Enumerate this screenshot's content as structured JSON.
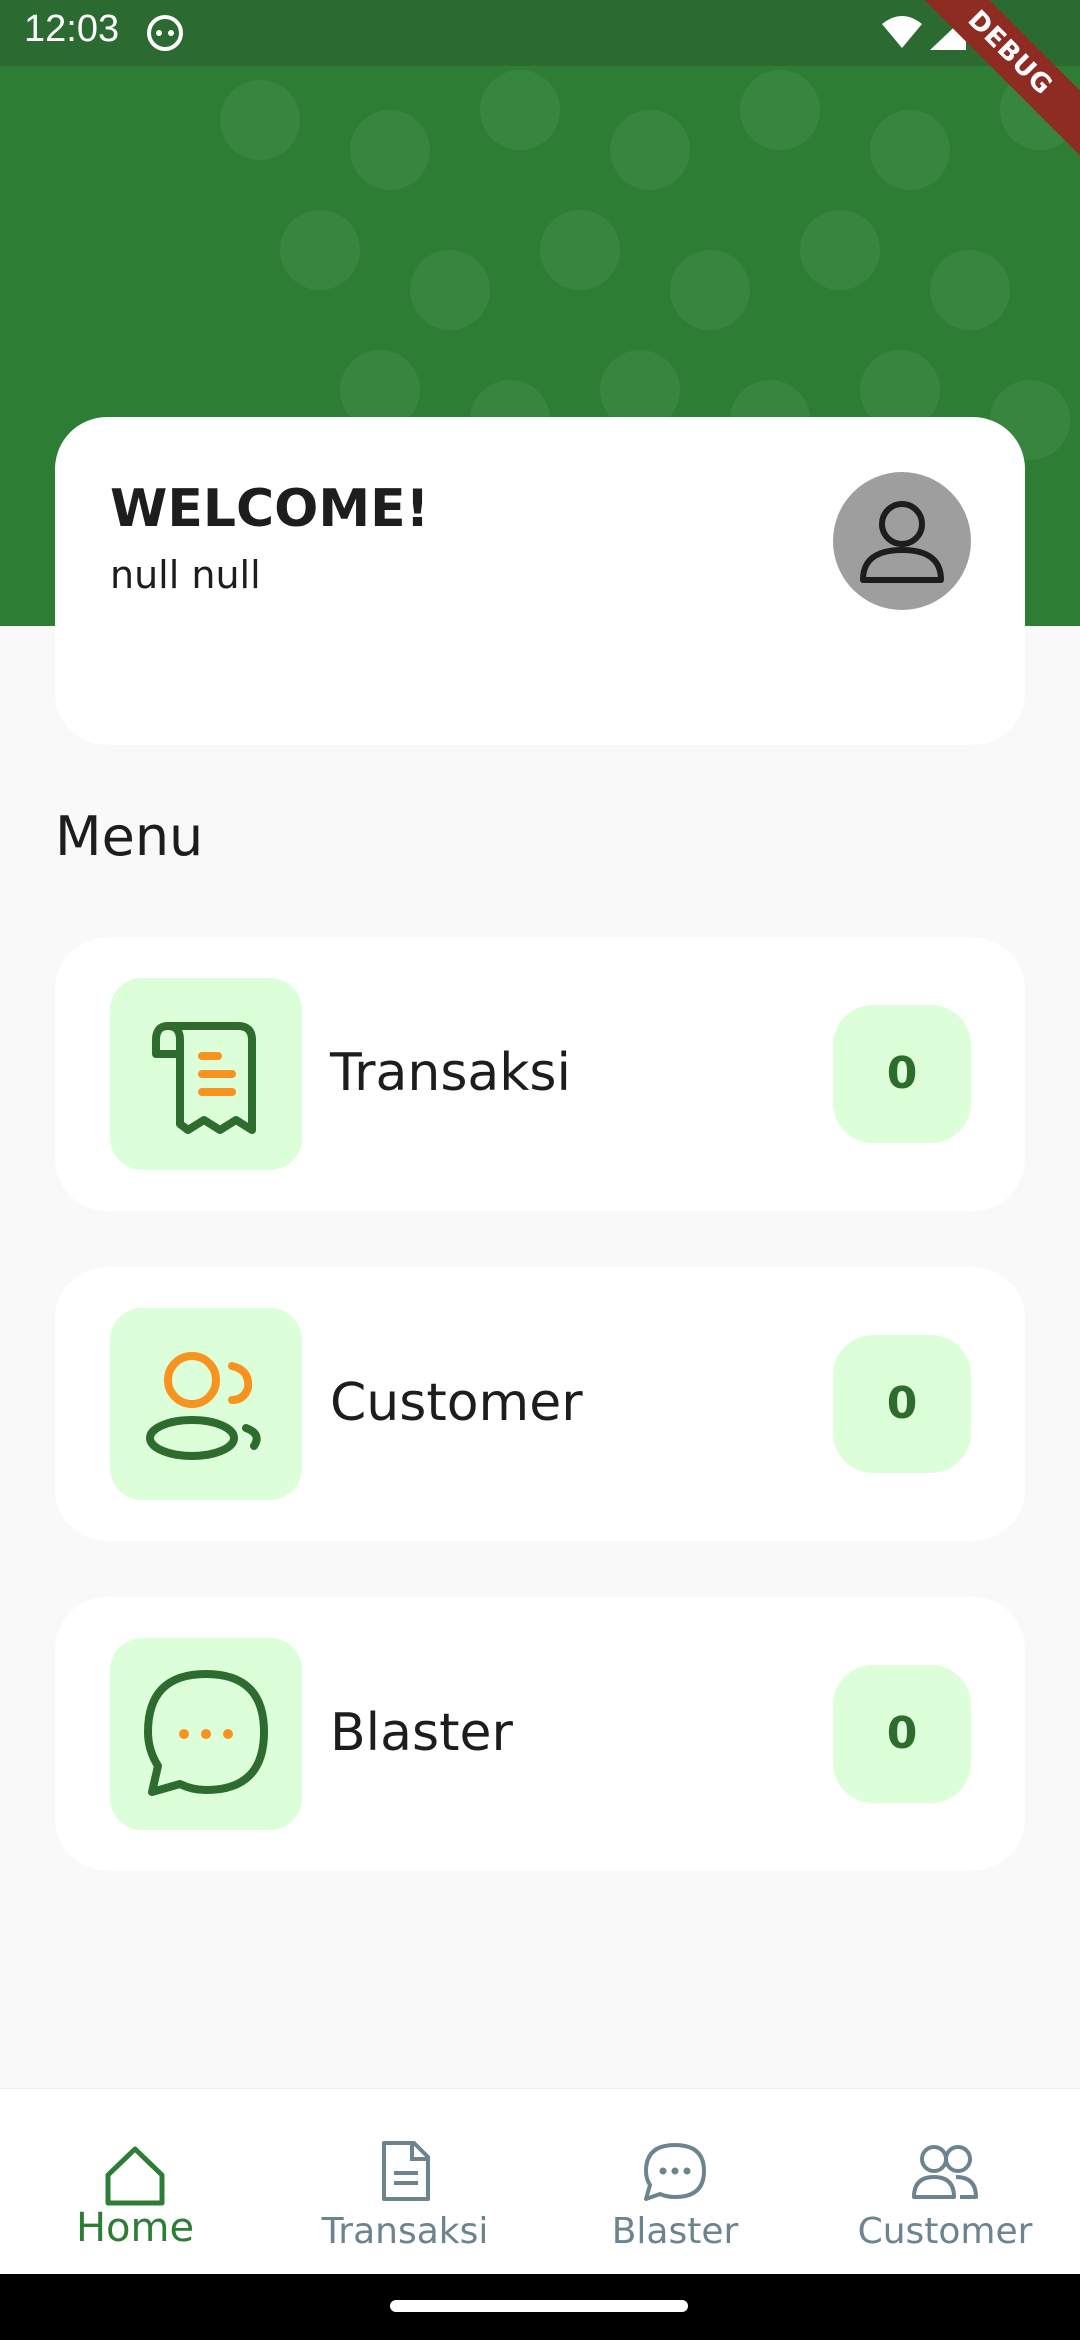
{
  "status_bar": {
    "time": "12:03",
    "debug_label": "DEBUG"
  },
  "welcome": {
    "title": "WELCOME!",
    "name": "null null"
  },
  "menu": {
    "title": "Menu",
    "items": [
      {
        "label": "Transaksi",
        "count": "0",
        "icon": "receipt-icon"
      },
      {
        "label": "Customer",
        "count": "0",
        "icon": "users-icon"
      },
      {
        "label": "Blaster",
        "count": "0",
        "icon": "chat-icon"
      }
    ]
  },
  "bottom_nav": {
    "items": [
      {
        "label": "Home",
        "icon": "home-icon",
        "active": true
      },
      {
        "label": "Transaksi",
        "icon": "document-icon",
        "active": false
      },
      {
        "label": "Blaster",
        "icon": "chat-icon",
        "active": false
      },
      {
        "label": "Customer",
        "icon": "users-icon",
        "active": false
      }
    ]
  },
  "colors": {
    "primary": "#2e7d35",
    "accent_orange": "#f7931e",
    "icon_bg": "#dcffd9",
    "debug_banner": "#8e2b22"
  }
}
